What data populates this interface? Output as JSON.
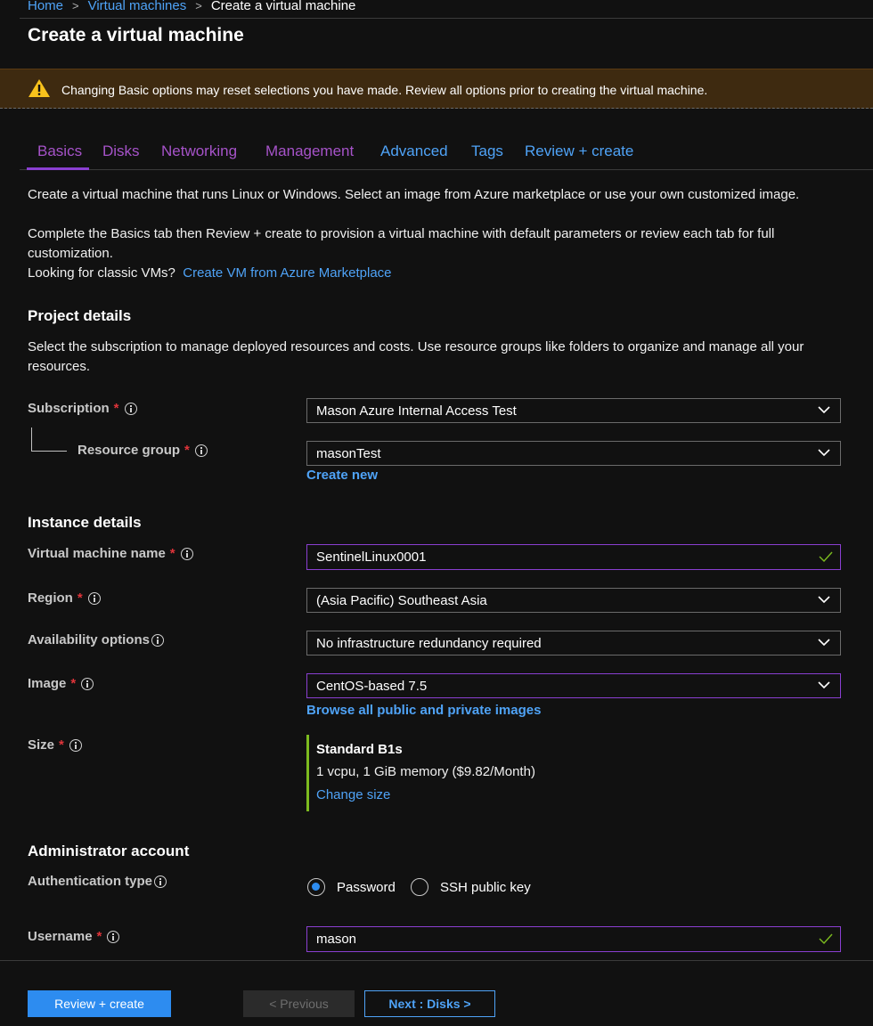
{
  "breadcrumb": {
    "home": "Home",
    "vms": "Virtual machines",
    "current": "Create a virtual machine",
    "separator": ">"
  },
  "page": {
    "title": "Create a virtual machine"
  },
  "banner": {
    "icon": "warning-icon",
    "text": "Changing Basic options may reset selections you have made. Review all options prior to creating the virtual machine."
  },
  "tabs": [
    {
      "label": "Basics",
      "state": "active"
    },
    {
      "label": "Disks",
      "state": "visited"
    },
    {
      "label": "Networking",
      "state": "visited"
    },
    {
      "label": "Management",
      "state": "visited"
    },
    {
      "label": "Advanced",
      "state": "link"
    },
    {
      "label": "Tags",
      "state": "link"
    },
    {
      "label": "Review + create",
      "state": "link"
    }
  ],
  "intro": {
    "line1": "Create a virtual machine that runs Linux or Windows. Select an image from Azure marketplace or use your own customized image.",
    "line2": "Complete the Basics tab then Review + create to provision a virtual machine with default parameters or review each tab for full customization.",
    "classic_prefix": "Looking for classic VMs?",
    "classic_link": "Create VM from Azure Marketplace"
  },
  "project": {
    "heading": "Project details",
    "desc": "Select the subscription to manage deployed resources and costs. Use resource groups like folders to organize and manage all your resources.",
    "subscription_label": "Subscription",
    "subscription_value": "Mason Azure Internal Access Test",
    "rg_label": "Resource group",
    "rg_value": "masonTest",
    "create_new": "Create new"
  },
  "instance": {
    "heading": "Instance details",
    "vm_name_label": "Virtual machine name",
    "vm_name_value": "SentinelLinux0001",
    "region_label": "Region",
    "region_value": "(Asia Pacific) Southeast Asia",
    "availability_label": "Availability options",
    "availability_value": "No infrastructure redundancy required",
    "image_label": "Image",
    "image_value": "CentOS-based 7.5",
    "browse_images": "Browse all public and private images",
    "size_label": "Size",
    "size_name": "Standard B1s",
    "size_desc": "1 vcpu, 1 GiB memory ($9.82/Month)",
    "change_size": "Change size"
  },
  "admin": {
    "heading": "Administrator account",
    "auth_label": "Authentication type",
    "auth_option_password": "Password",
    "auth_option_ssh": "SSH public key",
    "auth_selected": "Password",
    "username_label": "Username",
    "username_value": "mason"
  },
  "footer": {
    "review_create": "Review + create",
    "previous": "< Previous",
    "next": "Next : Disks >"
  },
  "colors": {
    "background": "#111111",
    "link": "#4fa3f7",
    "visited_tab": "#a653c9",
    "primary_button": "#2d8cf0",
    "warning_banner": "#3e2a10",
    "required": "#e0343a",
    "valid_check": "#7cbb1f"
  }
}
